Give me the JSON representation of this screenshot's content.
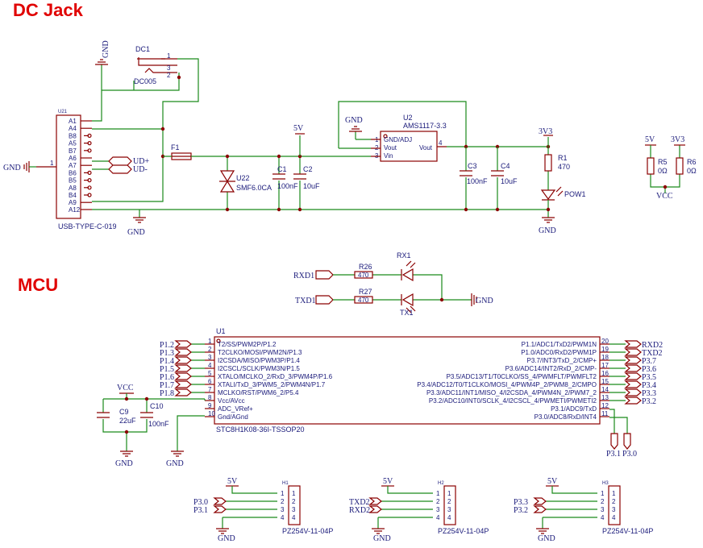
{
  "sections": {
    "dc_jack": "DC Jack",
    "mcu": "MCU"
  },
  "dc": {
    "ref": "DC1",
    "part": "DC005",
    "pins": [
      "1",
      "3",
      "2"
    ]
  },
  "usb": {
    "ref": "U21",
    "part": "USB-TYPE-C-019",
    "pins": [
      "A1",
      "A4",
      "B8",
      "A5",
      "B7",
      "A6",
      "A7",
      "B6",
      "B5",
      "A8",
      "B4",
      "A9",
      "A12"
    ],
    "pin1": "1",
    "shell": "GND",
    "dp": "UD+",
    "dm": "UD-"
  },
  "fuse": {
    "ref": "F1"
  },
  "tvs": {
    "ref": "U22",
    "part": "SMF6.0CA"
  },
  "caps": [
    {
      "ref": "C1",
      "value": "100nF"
    },
    {
      "ref": "C2",
      "value": "10uF"
    },
    {
      "ref": "C3",
      "value": "100nF"
    },
    {
      "ref": "C4",
      "value": "10uF"
    },
    {
      "ref": "C9",
      "value": "22uF"
    },
    {
      "ref": "C10",
      "value": "100nF"
    }
  ],
  "ldo": {
    "ref": "U2",
    "part": "AMS1117-3.3",
    "pin1": "GND/ADJ",
    "pin2": "Vout",
    "pin3": "Vin",
    "pin4": "Vout",
    "n1": "1",
    "n2": "2",
    "n3": "3",
    "n4": "4"
  },
  "power": {
    "r1": "R1",
    "r1v": "470",
    "led": "POW1",
    "r5": "R5",
    "r5v": "0Ω",
    "r6": "R6",
    "r6v": "0Ω"
  },
  "nets": {
    "gnd": "GND",
    "v5": "5V",
    "v33": "3V3",
    "vcc": "VCC"
  },
  "rx": {
    "net": "RXD1",
    "r": "R26",
    "rv": "470",
    "led": "RX1"
  },
  "tx": {
    "net": "TXD1",
    "r": "R27",
    "rv": "470",
    "led": "TX1"
  },
  "mcu": {
    "ref": "U1",
    "part": "STC8H1K08-36I-TSSOP20",
    "left": [
      {
        "n": "1",
        "name": "T2/SS/PWM2P/P1.2",
        "net": "P1.2"
      },
      {
        "n": "2",
        "name": "T2CLKO/MOSI/PWM2N/P1.3",
        "net": "P1.3"
      },
      {
        "n": "3",
        "name": "I2CSDA/MISO/PWM3P/P1.4",
        "net": "P1.4"
      },
      {
        "n": "4",
        "name": "I2CSCL/SCLK/PWM3N/P1.5",
        "net": "P1.5"
      },
      {
        "n": "5",
        "name": "XTALO/MCLKO_2/RxD_3/PWM4P/P1.6",
        "net": "P1.6"
      },
      {
        "n": "6",
        "name": "XTALI/TxD_3/PWM5_2/PWM4N/P1.7",
        "net": "P1.7"
      },
      {
        "n": "7",
        "name": "MCLKO/RST/PWM6_2/P5.4",
        "net": "P1.8"
      },
      {
        "n": "8",
        "name": "Vcc/AVcc",
        "net": ""
      },
      {
        "n": "9",
        "name": "ADC_VRef+",
        "net": ""
      },
      {
        "n": "10",
        "name": "Gnd/AGnd",
        "net": ""
      }
    ],
    "right": [
      {
        "n": "20",
        "name": "P1.1/ADC1/TxD2/PWM1N",
        "net": "RXD2"
      },
      {
        "n": "19",
        "name": "P1.0/ADC0/RxD2/PWM1P",
        "net": "TXD2"
      },
      {
        "n": "18",
        "name": "P3.7/INT3/TxD_2/CMP+",
        "net": "P3.7"
      },
      {
        "n": "17",
        "name": "P3.6/ADC14/INT2/RxD_2/CMP-",
        "net": "P3.6"
      },
      {
        "n": "16",
        "name": "P3.5/ADC13/T1/T0CLKO/SS_4/PWMFLT/PWMFLT2",
        "net": "P3.5"
      },
      {
        "n": "15",
        "name": "P3.4/ADC12/T0/T1CLKO/MOSI_4/PWM4P_2/PWM8_2/CMPO",
        "net": "P3.4"
      },
      {
        "n": "14",
        "name": "P3.3/ADC11/INT1/MISO_4/I2CSDA_4/PWM4N_2/PWM7_2",
        "net": "P3.3"
      },
      {
        "n": "13",
        "name": "P3.2/ADC10/INT0/SCLK_4/I2CSCL_4/PWMETI/PWMETI2",
        "net": "P3.2"
      },
      {
        "n": "12",
        "name": "P3.1/ADC9/TxD",
        "net": ""
      },
      {
        "n": "11",
        "name": "P3.0/ADC8/RxD/INT4",
        "net": ""
      }
    ],
    "bottom_nets": [
      "P3.1",
      "P3.0"
    ]
  },
  "headers": [
    {
      "ref": "H1",
      "part": "PZ254V-11-04P",
      "nets": [
        "P3.0",
        "P3.1"
      ]
    },
    {
      "ref": "H2",
      "part": "PZ254V-11-04P",
      "nets": [
        "TXD2",
        "RXD2"
      ]
    },
    {
      "ref": "H3",
      "part": "PZ254V-11-04P",
      "nets": [
        "P3.3",
        "P3.2"
      ]
    }
  ],
  "header_pins": [
    "1",
    "2",
    "3",
    "4"
  ]
}
